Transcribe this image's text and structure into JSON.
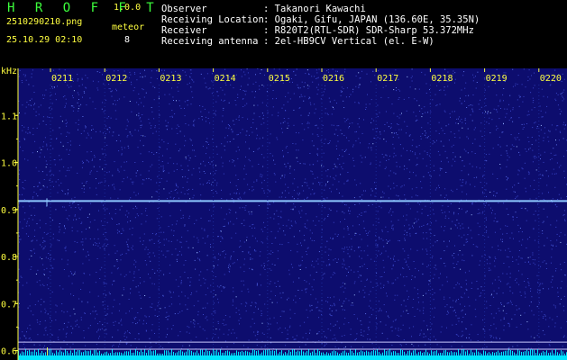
{
  "app": {
    "title": "H R O F F T",
    "version": "1.0.0",
    "file_name": "2510290210.png",
    "date_time": "25.10.29 02:10",
    "meteor_label": "meteor",
    "meteor_count": "8"
  },
  "info": [
    {
      "label": "Observer",
      "value": ": Takanori Kawachi"
    },
    {
      "label": "Receiving Location",
      "value": ": Ogaki, Gifu, JAPAN (136.60E, 35.35N)"
    },
    {
      "label": "Receiver",
      "value": ": R820T2(RTL-SDR) SDR-Sharp 53.372MHz"
    },
    {
      "label": "Receiving antenna",
      "value": ": 2el-HB9CV Vertical (el. E-W)"
    }
  ],
  "chart_data": {
    "type": "heatmap",
    "ylabel": "kHz",
    "x_ticks": [
      "0211",
      "0212",
      "0213",
      "0214",
      "0215",
      "0216",
      "0217",
      "0218",
      "0219",
      "0220"
    ],
    "y_ticks": [
      "1.1",
      "1.0",
      "0.9",
      "0.8",
      "0.7",
      "0.6"
    ],
    "ylim": [
      0.58,
      1.2
    ],
    "carrier_khz": 0.918,
    "reference_lines_khz": [
      0.618,
      0.603
    ],
    "colors": {
      "background": "#0d0d6e",
      "noise": "#3a46c8",
      "carrier": "#8ec8ff",
      "bottom_band": "#00e5ff",
      "ticks": "#ffff40"
    }
  }
}
